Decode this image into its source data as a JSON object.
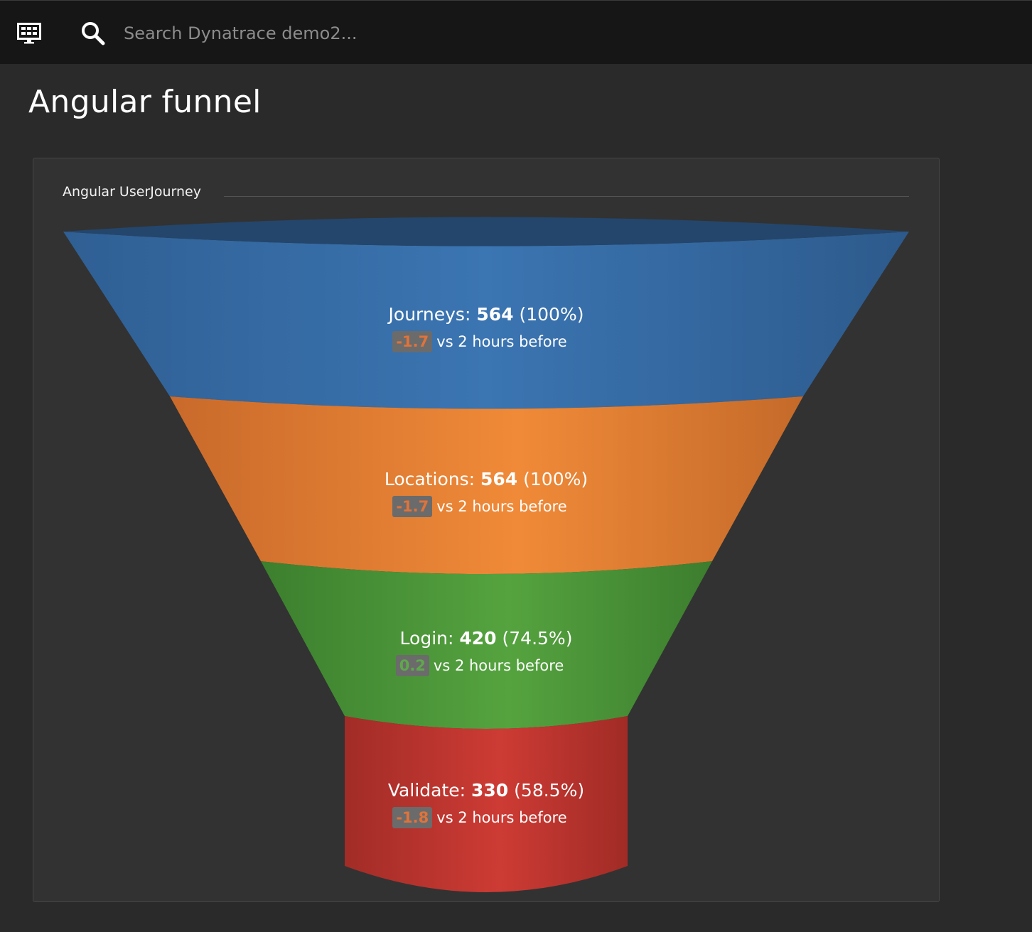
{
  "topbar": {
    "menu_icon": "monitor-icon",
    "search_icon": "search-icon",
    "search_placeholder": "Search Dynatrace demo2..."
  },
  "page": {
    "title": "Angular funnel"
  },
  "tile": {
    "title": "Angular UserJourney"
  },
  "chart_data": {
    "type": "funnel",
    "title": "Angular UserJourney",
    "comparison_text": "vs 2 hours before",
    "stages": [
      {
        "name": "Journeys",
        "value": 564,
        "percent": "(100%)",
        "delta": "-1.7",
        "delta_trend": "negative",
        "color": "#3a6fa8"
      },
      {
        "name": "Locations",
        "value": 564,
        "percent": "(100%)",
        "delta": "-1.7",
        "delta_trend": "negative",
        "color": "#ea8232"
      },
      {
        "name": "Login",
        "value": 420,
        "percent": "(74.5%)",
        "delta": "0.2",
        "delta_trend": "positive",
        "color": "#4f9a3c"
      },
      {
        "name": "Validate",
        "value": 330,
        "percent": "(58.5%)",
        "delta": "-1.8",
        "delta_trend": "negative",
        "color": "#c53a33"
      }
    ]
  }
}
